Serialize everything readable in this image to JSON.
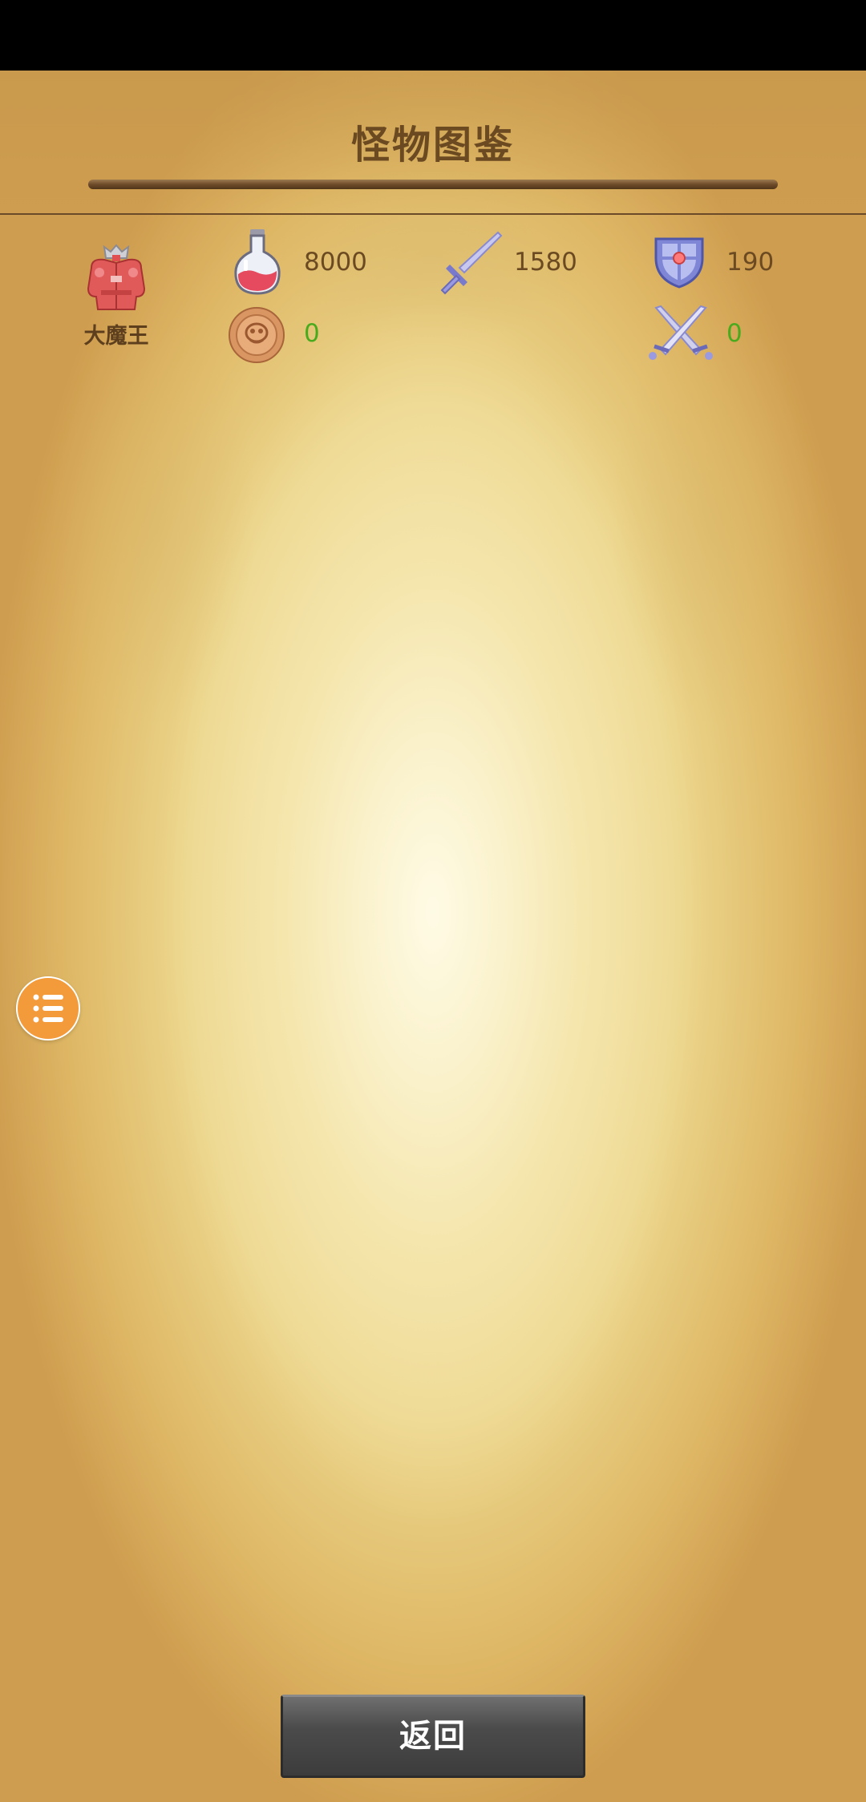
{
  "header": {
    "title": "怪物图鉴"
  },
  "monster": {
    "name": "大魔王",
    "icon": "demon-lord-armor-icon",
    "hp": "8000",
    "attack": "1580",
    "defense": "190",
    "gold": "0",
    "damage": "0"
  },
  "icons": {
    "hp": "potion-icon",
    "attack": "sword-icon",
    "defense": "shield-icon",
    "gold": "coin-icon",
    "damage": "crossed-swords-icon",
    "menu": "list-icon"
  },
  "colors": {
    "title": "#6b4a22",
    "stat_text": "#6b4a22",
    "green_value": "#4aaa1e",
    "float_button": "#f39a3b"
  },
  "footer": {
    "back_label": "返回"
  }
}
